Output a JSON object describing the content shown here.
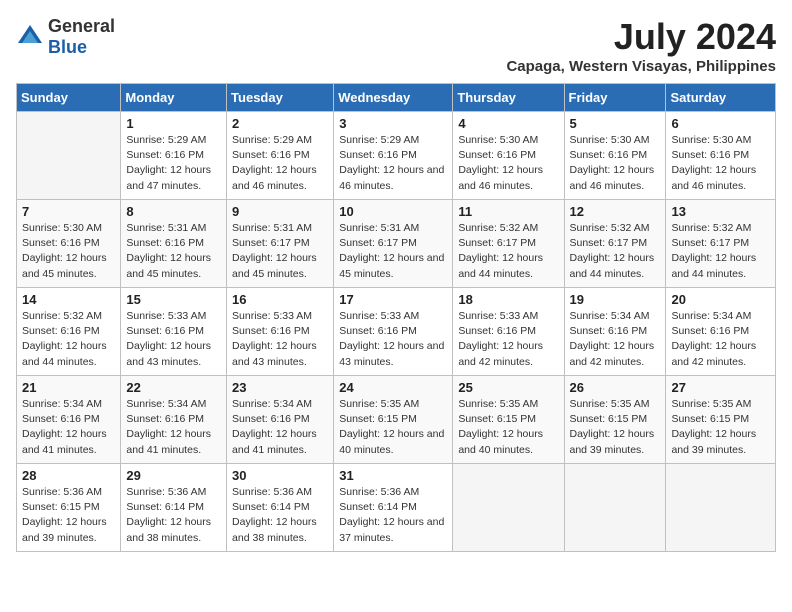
{
  "logo": {
    "general": "General",
    "blue": "Blue"
  },
  "title": {
    "month_year": "July 2024",
    "location": "Capaga, Western Visayas, Philippines"
  },
  "weekdays": [
    "Sunday",
    "Monday",
    "Tuesday",
    "Wednesday",
    "Thursday",
    "Friday",
    "Saturday"
  ],
  "weeks": [
    [
      {
        "day": "",
        "sunrise": "",
        "sunset": "",
        "daylight": ""
      },
      {
        "day": "1",
        "sunrise": "Sunrise: 5:29 AM",
        "sunset": "Sunset: 6:16 PM",
        "daylight": "Daylight: 12 hours and 47 minutes."
      },
      {
        "day": "2",
        "sunrise": "Sunrise: 5:29 AM",
        "sunset": "Sunset: 6:16 PM",
        "daylight": "Daylight: 12 hours and 46 minutes."
      },
      {
        "day": "3",
        "sunrise": "Sunrise: 5:29 AM",
        "sunset": "Sunset: 6:16 PM",
        "daylight": "Daylight: 12 hours and 46 minutes."
      },
      {
        "day": "4",
        "sunrise": "Sunrise: 5:30 AM",
        "sunset": "Sunset: 6:16 PM",
        "daylight": "Daylight: 12 hours and 46 minutes."
      },
      {
        "day": "5",
        "sunrise": "Sunrise: 5:30 AM",
        "sunset": "Sunset: 6:16 PM",
        "daylight": "Daylight: 12 hours and 46 minutes."
      },
      {
        "day": "6",
        "sunrise": "Sunrise: 5:30 AM",
        "sunset": "Sunset: 6:16 PM",
        "daylight": "Daylight: 12 hours and 46 minutes."
      }
    ],
    [
      {
        "day": "7",
        "sunrise": "Sunrise: 5:30 AM",
        "sunset": "Sunset: 6:16 PM",
        "daylight": "Daylight: 12 hours and 45 minutes."
      },
      {
        "day": "8",
        "sunrise": "Sunrise: 5:31 AM",
        "sunset": "Sunset: 6:16 PM",
        "daylight": "Daylight: 12 hours and 45 minutes."
      },
      {
        "day": "9",
        "sunrise": "Sunrise: 5:31 AM",
        "sunset": "Sunset: 6:17 PM",
        "daylight": "Daylight: 12 hours and 45 minutes."
      },
      {
        "day": "10",
        "sunrise": "Sunrise: 5:31 AM",
        "sunset": "Sunset: 6:17 PM",
        "daylight": "Daylight: 12 hours and 45 minutes."
      },
      {
        "day": "11",
        "sunrise": "Sunrise: 5:32 AM",
        "sunset": "Sunset: 6:17 PM",
        "daylight": "Daylight: 12 hours and 44 minutes."
      },
      {
        "day": "12",
        "sunrise": "Sunrise: 5:32 AM",
        "sunset": "Sunset: 6:17 PM",
        "daylight": "Daylight: 12 hours and 44 minutes."
      },
      {
        "day": "13",
        "sunrise": "Sunrise: 5:32 AM",
        "sunset": "Sunset: 6:17 PM",
        "daylight": "Daylight: 12 hours and 44 minutes."
      }
    ],
    [
      {
        "day": "14",
        "sunrise": "Sunrise: 5:32 AM",
        "sunset": "Sunset: 6:16 PM",
        "daylight": "Daylight: 12 hours and 44 minutes."
      },
      {
        "day": "15",
        "sunrise": "Sunrise: 5:33 AM",
        "sunset": "Sunset: 6:16 PM",
        "daylight": "Daylight: 12 hours and 43 minutes."
      },
      {
        "day": "16",
        "sunrise": "Sunrise: 5:33 AM",
        "sunset": "Sunset: 6:16 PM",
        "daylight": "Daylight: 12 hours and 43 minutes."
      },
      {
        "day": "17",
        "sunrise": "Sunrise: 5:33 AM",
        "sunset": "Sunset: 6:16 PM",
        "daylight": "Daylight: 12 hours and 43 minutes."
      },
      {
        "day": "18",
        "sunrise": "Sunrise: 5:33 AM",
        "sunset": "Sunset: 6:16 PM",
        "daylight": "Daylight: 12 hours and 42 minutes."
      },
      {
        "day": "19",
        "sunrise": "Sunrise: 5:34 AM",
        "sunset": "Sunset: 6:16 PM",
        "daylight": "Daylight: 12 hours and 42 minutes."
      },
      {
        "day": "20",
        "sunrise": "Sunrise: 5:34 AM",
        "sunset": "Sunset: 6:16 PM",
        "daylight": "Daylight: 12 hours and 42 minutes."
      }
    ],
    [
      {
        "day": "21",
        "sunrise": "Sunrise: 5:34 AM",
        "sunset": "Sunset: 6:16 PM",
        "daylight": "Daylight: 12 hours and 41 minutes."
      },
      {
        "day": "22",
        "sunrise": "Sunrise: 5:34 AM",
        "sunset": "Sunset: 6:16 PM",
        "daylight": "Daylight: 12 hours and 41 minutes."
      },
      {
        "day": "23",
        "sunrise": "Sunrise: 5:34 AM",
        "sunset": "Sunset: 6:16 PM",
        "daylight": "Daylight: 12 hours and 41 minutes."
      },
      {
        "day": "24",
        "sunrise": "Sunrise: 5:35 AM",
        "sunset": "Sunset: 6:15 PM",
        "daylight": "Daylight: 12 hours and 40 minutes."
      },
      {
        "day": "25",
        "sunrise": "Sunrise: 5:35 AM",
        "sunset": "Sunset: 6:15 PM",
        "daylight": "Daylight: 12 hours and 40 minutes."
      },
      {
        "day": "26",
        "sunrise": "Sunrise: 5:35 AM",
        "sunset": "Sunset: 6:15 PM",
        "daylight": "Daylight: 12 hours and 39 minutes."
      },
      {
        "day": "27",
        "sunrise": "Sunrise: 5:35 AM",
        "sunset": "Sunset: 6:15 PM",
        "daylight": "Daylight: 12 hours and 39 minutes."
      }
    ],
    [
      {
        "day": "28",
        "sunrise": "Sunrise: 5:36 AM",
        "sunset": "Sunset: 6:15 PM",
        "daylight": "Daylight: 12 hours and 39 minutes."
      },
      {
        "day": "29",
        "sunrise": "Sunrise: 5:36 AM",
        "sunset": "Sunset: 6:14 PM",
        "daylight": "Daylight: 12 hours and 38 minutes."
      },
      {
        "day": "30",
        "sunrise": "Sunrise: 5:36 AM",
        "sunset": "Sunset: 6:14 PM",
        "daylight": "Daylight: 12 hours and 38 minutes."
      },
      {
        "day": "31",
        "sunrise": "Sunrise: 5:36 AM",
        "sunset": "Sunset: 6:14 PM",
        "daylight": "Daylight: 12 hours and 37 minutes."
      },
      {
        "day": "",
        "sunrise": "",
        "sunset": "",
        "daylight": ""
      },
      {
        "day": "",
        "sunrise": "",
        "sunset": "",
        "daylight": ""
      },
      {
        "day": "",
        "sunrise": "",
        "sunset": "",
        "daylight": ""
      }
    ]
  ]
}
